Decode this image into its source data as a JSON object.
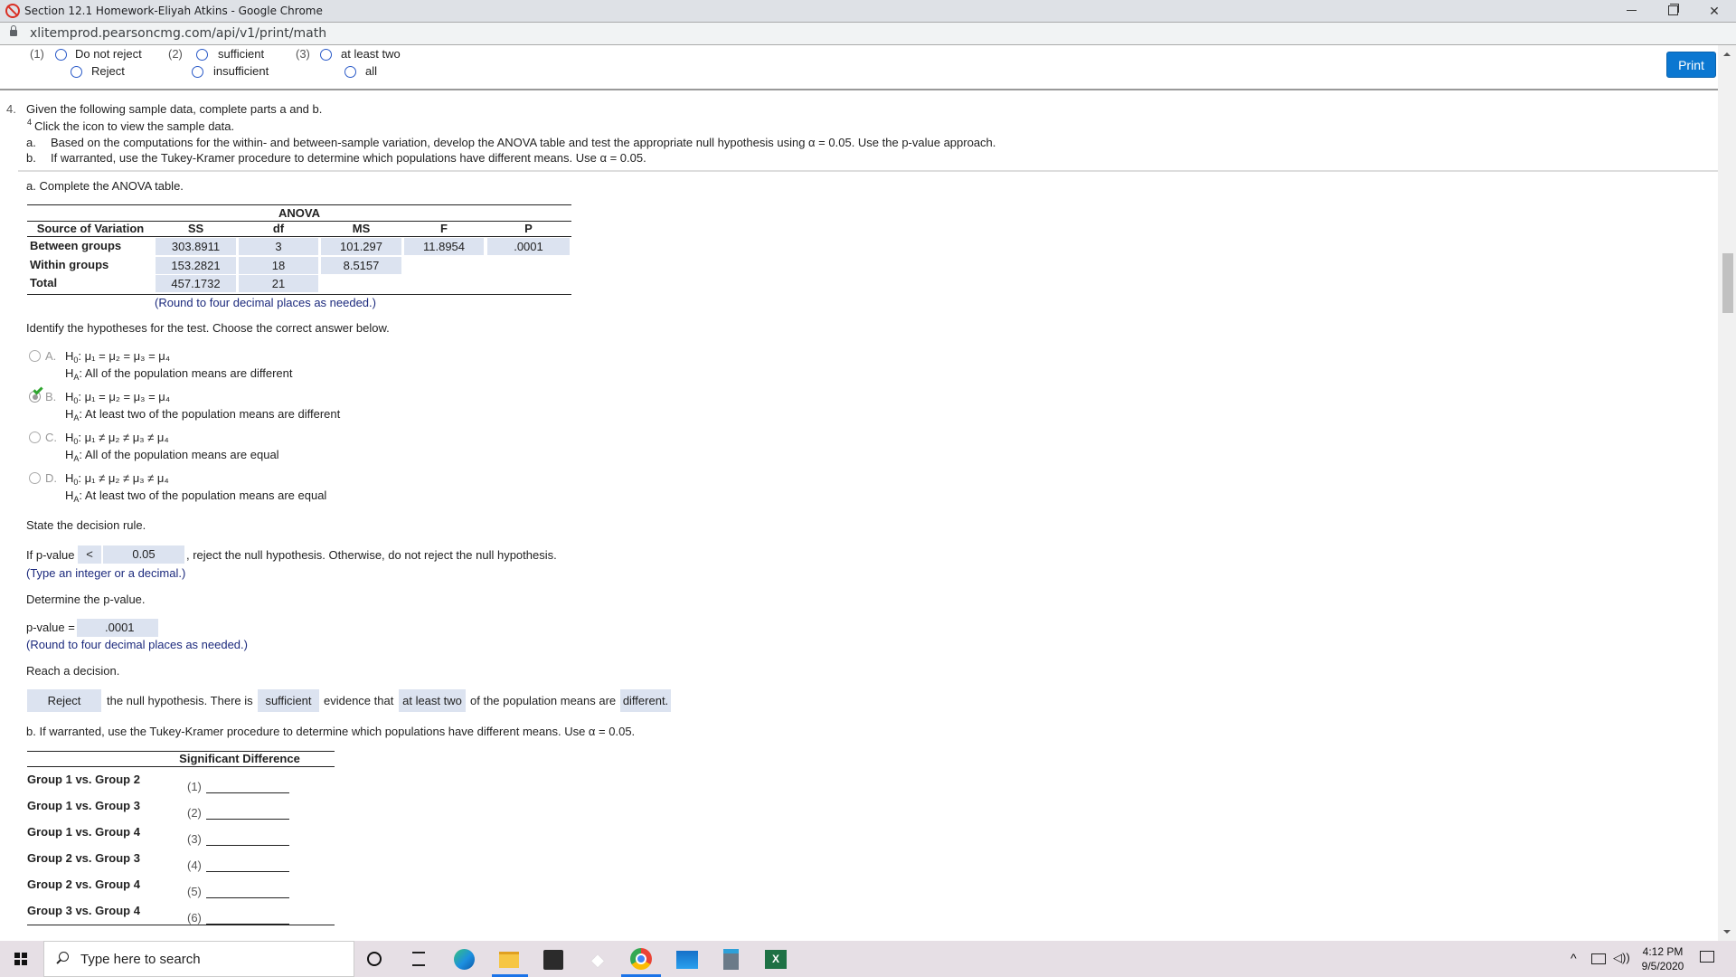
{
  "window": {
    "title": "Section 12.1 Homework-Eliyah Atkins - Google Chrome",
    "url": "xlitemprod.pearsoncmg.com/api/v1/print/math",
    "minimize_icon": "minimize-icon",
    "maximize_icon": "restore-icon",
    "close_icon": "close-icon"
  },
  "legend": {
    "groups": [
      {
        "num": "(1)",
        "options": [
          "Do not reject",
          "Reject"
        ]
      },
      {
        "num": "(2)",
        "options": [
          "sufficient",
          "insufficient"
        ]
      },
      {
        "num": "(3)",
        "options": [
          "at least two",
          "all"
        ]
      }
    ]
  },
  "print_button": "Print",
  "question": {
    "number": "4.",
    "intro": "Given the following sample data, complete parts a and b.",
    "footnote_mark": "4",
    "footnote_text": "Click the icon to view the sample data.",
    "parts": [
      {
        "label": "a.",
        "text": "Based on the computations for the within- and between-sample variation, develop the ANOVA table and test the appropriate null hypothesis using α = 0.05. Use the p-value approach."
      },
      {
        "label": "b.",
        "text": "If warranted, use the Tukey-Kramer procedure to determine which populations have different means. Use α = 0.05."
      }
    ]
  },
  "part_a": {
    "heading": "a. Complete the ANOVA table.",
    "anova": {
      "title": "ANOVA",
      "columns": [
        "Source of Variation",
        "SS",
        "df",
        "MS",
        "F",
        "P"
      ],
      "rows": [
        {
          "source": "Between groups",
          "ss": "303.8911",
          "df": "3",
          "ms": "101.297",
          "f": "11.8954",
          "p": ".0001"
        },
        {
          "source": "Within groups",
          "ss": "153.2821",
          "df": "18",
          "ms": "8.5157"
        },
        {
          "source": "Total",
          "ss": "457.1732",
          "df": "21"
        }
      ],
      "note": "(Round to four decimal places as needed.)"
    },
    "hypotheses": {
      "prompt": "Identify the hypotheses for the test. Choose the correct answer below.",
      "selected": "B",
      "options": [
        {
          "letter": "A.",
          "h0": "μ₁ = μ₂ = μ₃ = μ₄",
          "ha": "All of the population means are different"
        },
        {
          "letter": "B.",
          "h0": "μ₁ = μ₂ = μ₃ = μ₄",
          "ha": "At least two of the population means are different"
        },
        {
          "letter": "C.",
          "h0": "μ₁ ≠ μ₂ ≠ μ₃ ≠ μ₄",
          "ha": "All of the population means are equal"
        },
        {
          "letter": "D.",
          "h0": "μ₁ ≠ μ₂ ≠ μ₃ ≠ μ₄",
          "ha": "At least two of the population means are equal"
        }
      ],
      "h0_label": "H",
      "h0_sub": "0",
      "ha_label": "H",
      "ha_sub": "A"
    },
    "decision_rule": {
      "prompt": "State the decision rule.",
      "prefix": "If p-value",
      "operator": "<",
      "value": "0.05",
      "suffix": ", reject the null hypothesis. Otherwise, do not reject the null hypothesis.",
      "hint": "(Type an integer or a decimal.)"
    },
    "p_value": {
      "prompt": "Determine the p-value.",
      "label": "p-value =",
      "value": ".0001",
      "hint": "(Round to four decimal places as needed.)"
    },
    "decision": {
      "prompt": "Reach a decision.",
      "choice1": "Reject",
      "text1": "the null hypothesis. There is",
      "choice2": "sufficient",
      "text2": "evidence that",
      "choice3": "at least two",
      "text3": "of the population means are",
      "choice4": "different."
    }
  },
  "part_b": {
    "heading": "b. If warranted, use the Tukey-Kramer procedure to determine which populations have different means. Use α = 0.05.",
    "table_header": "Significant Difference",
    "rows": [
      {
        "label": "Group 1 vs. Group 2",
        "num": "(1)",
        "value": ""
      },
      {
        "label": "Group 1 vs. Group 3",
        "num": "(2)",
        "value": ""
      },
      {
        "label": "Group 1 vs. Group 4",
        "num": "(3)",
        "value": ""
      },
      {
        "label": "Group 2 vs. Group 3",
        "num": "(4)",
        "value": ""
      },
      {
        "label": "Group 2 vs. Group 4",
        "num": "(5)",
        "value": ""
      },
      {
        "label": "Group 3 vs. Group 4",
        "num": "(6)",
        "value": ""
      }
    ]
  },
  "taskbar": {
    "search_placeholder": "Type here to search",
    "apps": [
      "cortana",
      "task-view",
      "edge",
      "file-explorer",
      "store",
      "dropbox",
      "chrome",
      "mail",
      "calculator",
      "excel"
    ],
    "time": "4:12 PM",
    "date": "9/5/2020"
  }
}
